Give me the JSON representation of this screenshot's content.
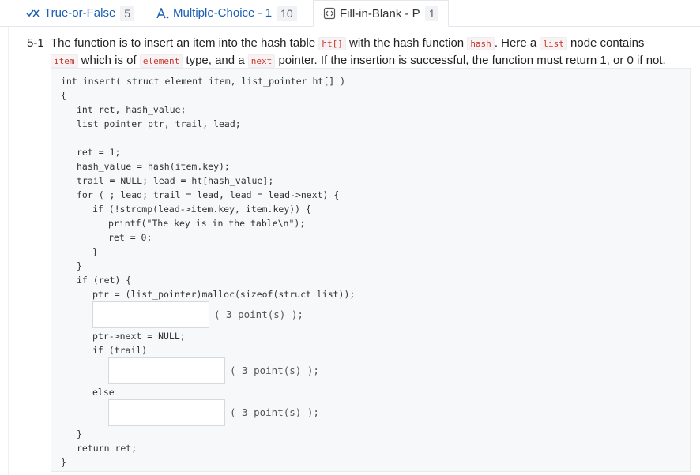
{
  "tabs": [
    {
      "label": "True-or-False",
      "count": "5",
      "icon": "true-false-icon"
    },
    {
      "label": "Multiple-Choice - 1",
      "count": "10",
      "icon": "choice-icon"
    },
    {
      "label": "Fill-in-Blank - P",
      "count": "1",
      "icon": "code-blank-icon"
    }
  ],
  "question": {
    "number": "5-1",
    "t1": "The function is to insert an item into the hash table ",
    "c1": "ht[]",
    "t2": " with the hash function ",
    "c2": "hash",
    "t3": ". Here a ",
    "c3": "list",
    "t4": " node contains",
    "c4": "item",
    "t5": " which is of ",
    "c5": "element",
    "t6": " type, and a ",
    "c6": "next",
    "t7": " pointer. If the insertion is successful, the function must return 1, or 0 if not."
  },
  "code_lines": [
    "int insert( struct element item, list_pointer ht[] )",
    "{",
    "int ret, hash_value;",
    "list_pointer ptr, trail, lead;",
    "ret = 1;",
    "hash_value = hash(item.key);",
    "trail = NULL; lead = ht[hash_value];",
    "for ( ; lead; trail = lead, lead = lead->next) {",
    "if (!strcmp(lead->item.key, item.key)) {",
    "printf(\"The key is in the table\\n\");",
    "ret = 0;",
    "}",
    "}",
    "if (ret) {",
    "ptr = (list_pointer)malloc(sizeof(struct list));",
    "ptr->next = NULL;",
    "if (trail)",
    "else",
    "}",
    "return ret;",
    "}"
  ],
  "blanks": [
    {
      "value": "",
      "points": "( 3 point(s) );"
    },
    {
      "value": "",
      "points": "( 3 point(s) );"
    },
    {
      "value": "",
      "points": "( 3 point(s) );"
    }
  ],
  "colors": {
    "accent": "#1a5fb4",
    "code_bg": "#f6f8fa",
    "inline_code": "#c0392b"
  }
}
